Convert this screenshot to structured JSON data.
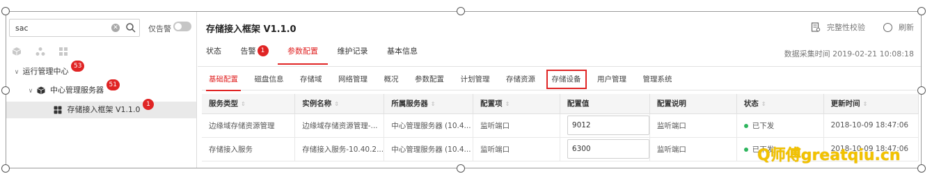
{
  "left_panel": {
    "search": {
      "value": "sac",
      "placeholder": ""
    },
    "alarm_only_label": "仅告警",
    "tree": [
      {
        "label": "运行管理中心",
        "badge": "53"
      },
      {
        "label": "中心管理服务器",
        "badge": "51"
      },
      {
        "label": "存储接入框架 V1.1.0",
        "badge": "1"
      }
    ]
  },
  "header": {
    "title": "存储接入框架 V1.1.0",
    "integrity_check": "完整性校验",
    "refresh": "刷新",
    "collect_time": "数据采集时间  2019-02-21 10:08:18"
  },
  "main_tabs": [
    {
      "label": "状态"
    },
    {
      "label": "告警",
      "badge": "1"
    },
    {
      "label": "参数配置",
      "active": true
    },
    {
      "label": "维护记录"
    },
    {
      "label": "基本信息"
    }
  ],
  "sub_tabs": [
    {
      "label": "基础配置",
      "active": true
    },
    {
      "label": "磁盘信息"
    },
    {
      "label": "存储域"
    },
    {
      "label": "网络管理"
    },
    {
      "label": "概况"
    },
    {
      "label": "参数配置"
    },
    {
      "label": "计划管理"
    },
    {
      "label": "存储资源"
    },
    {
      "label": "存储设备",
      "highlighted": true
    },
    {
      "label": "用户管理"
    },
    {
      "label": "管理系统"
    }
  ],
  "table": {
    "columns": [
      "服务类型",
      "实例名称",
      "所属服务器",
      "配置项",
      "配置值",
      "配置说明",
      "状态",
      "更新时间"
    ],
    "rows": [
      [
        "边缘域存储资源管理",
        "边缘域存储资源管理-...",
        "中心管理服务器 (10.4...",
        "监听端口",
        "9012",
        "监听端口",
        "已下发",
        "2018-10-09 18:47:06"
      ],
      [
        "存储接入服务",
        "存储接入服务-10.40.2...",
        "中心管理服务器 (10.4...",
        "监听端口",
        "6300",
        "监听端口",
        "已下发",
        "2018-10-09 18:47:06"
      ]
    ]
  },
  "watermark": "Q师傅greatqiu.cn",
  "colors": {
    "accent": "#e02424",
    "status_ok": "#2db55d",
    "watermark": "#f2c200"
  }
}
